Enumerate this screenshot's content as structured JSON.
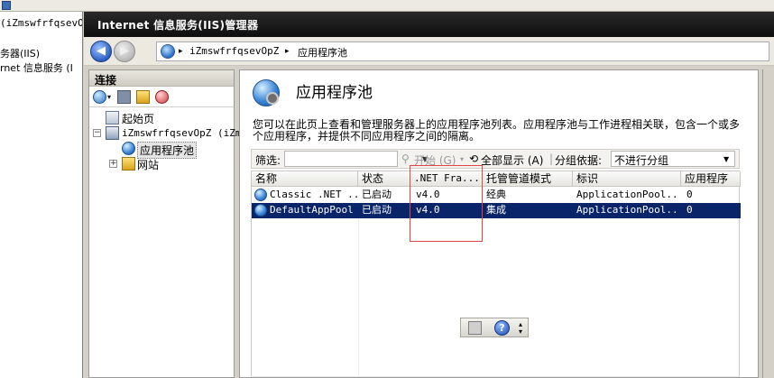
{
  "left_window": {
    "lines": [
      "(iZmswfrfqsevOp",
      "务器(IIS)",
      "rnet 信息服务 (I"
    ]
  },
  "window": {
    "title": "Internet 信息服务(IIS)管理器"
  },
  "address": {
    "crumbs": [
      "iZmswfrfqsevOpZ",
      "应用程序池"
    ],
    "separator": "▸"
  },
  "connections": {
    "title": "连接",
    "tree": [
      {
        "label": "起始页"
      },
      {
        "label": "iZmswfrfqsevOpZ (iZm"
      },
      {
        "label": "应用程序池"
      },
      {
        "label": "网站"
      }
    ]
  },
  "content": {
    "title": "应用程序池",
    "description": "您可以在此页上查看和管理服务器上的应用程序池列表。应用程序池与工作进程相关联，包含一个或多个应用程序，并提供不同应用程序之间的隔离。",
    "filter": {
      "label": "筛选:",
      "start_label": "开始 (G)",
      "show_all_label": "全部显示 (A)",
      "group_label": "分组依据:",
      "group_value": "不进行分组"
    },
    "columns": [
      "名称",
      "状态",
      ".NET Fra...",
      "托管管道模式",
      "标识",
      "应用程序"
    ],
    "rows": [
      {
        "name": "Classic .NET ...",
        "status": "已启动",
        "net": "v4.0",
        "pipeline": "经典",
        "identity": "ApplicationPool...",
        "apps": "0"
      },
      {
        "name": "DefaultAppPool",
        "status": "已启动",
        "net": "v4.0",
        "pipeline": "集成",
        "identity": "ApplicationPool...",
        "apps": "0"
      }
    ],
    "selected_row": 1
  },
  "colors": {
    "selection": "#0a246a",
    "highlight_box": "#e04646",
    "title_bar": "#111111"
  }
}
